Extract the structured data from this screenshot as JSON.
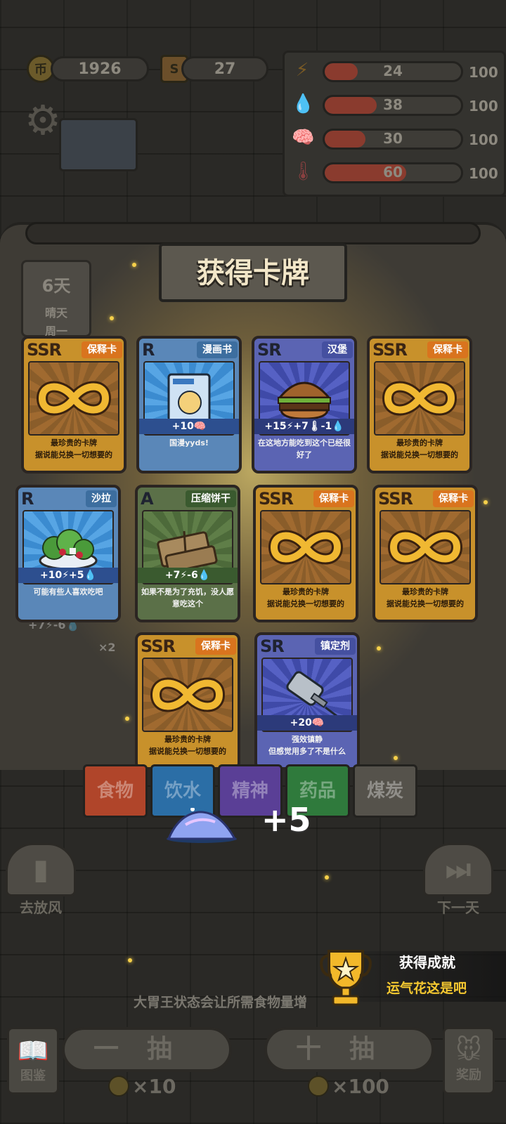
{
  "hud": {
    "coins": "1926",
    "tickets": "27",
    "coin_symbol": "币",
    "ticket_symbol": "S",
    "stats": [
      {
        "icon": "lightning-icon",
        "glyph": "⚡",
        "value": "24",
        "max": "100",
        "level": 0.24
      },
      {
        "icon": "water-drop-icon",
        "glyph": "💧",
        "value": "38",
        "max": "100",
        "level": 0.38
      },
      {
        "icon": "brain-icon",
        "glyph": "🧠",
        "value": "30",
        "max": "100",
        "level": 0.3
      },
      {
        "icon": "thermometer-icon",
        "glyph": "🌡",
        "value": "60",
        "max": "100",
        "level": 0.6
      }
    ]
  },
  "panel": {
    "title": "获得卡牌",
    "day": "6天",
    "weather": "晴天",
    "weekday": "周一",
    "left_status": "+7⚡-6💧",
    "left_multiplier": "×2"
  },
  "cards": [
    {
      "rarity": "SSR",
      "tag": "保释卡",
      "style": "gold",
      "effect": "",
      "desc": "最珍贵的卡牌\n据说能兑换一切想要的",
      "art": "infinity-icon"
    },
    {
      "rarity": "R",
      "tag": "漫画书",
      "style": "blue",
      "effect": "+10🧠",
      "desc": "国漫yyds!",
      "art": "comic-book-icon"
    },
    {
      "rarity": "SR",
      "tag": "汉堡",
      "style": "violet",
      "effect": "+15⚡+7🌡-1💧",
      "desc": "在这地方能吃到这个已经很好了",
      "art": "burger-icon"
    },
    {
      "rarity": "SSR",
      "tag": "保释卡",
      "style": "gold",
      "effect": "",
      "desc": "最珍贵的卡牌\n据说能兑换一切想要的",
      "art": "infinity-icon"
    },
    {
      "rarity": "R",
      "tag": "沙拉",
      "style": "blue",
      "effect": "+10⚡+5💧",
      "desc": "可能有些人喜欢吃吧",
      "art": "salad-icon"
    },
    {
      "rarity": "A",
      "tag": "压缩饼干",
      "style": "green",
      "effect": "+7⚡-6💧",
      "desc": "如果不是为了充饥，没人愿意吃这个",
      "art": "biscuit-icon"
    },
    {
      "rarity": "SSR",
      "tag": "保释卡",
      "style": "gold",
      "effect": "",
      "desc": "最珍贵的卡牌\n据说能兑换一切想要的",
      "art": "infinity-icon"
    },
    {
      "rarity": "SSR",
      "tag": "保释卡",
      "style": "gold",
      "effect": "",
      "desc": "最珍贵的卡牌\n据说能兑换一切想要的",
      "art": "infinity-icon"
    },
    {
      "rarity": "SSR",
      "tag": "保释卡",
      "style": "gold",
      "effect": "",
      "desc": "最珍贵的卡牌\n据说能兑换一切想要的",
      "art": "infinity-icon"
    },
    {
      "rarity": "SR",
      "tag": "镇定剂",
      "style": "violet",
      "effect": "+20🧠",
      "desc": "强效镇静\n但感觉用多了不是什么",
      "art": "syringe-icon"
    }
  ],
  "tabs": [
    {
      "label": "食物",
      "color": "#b0452a"
    },
    {
      "label": "饮水",
      "color": "#2b6ea6"
    },
    {
      "label": "精神",
      "color": "#5a3f96"
    },
    {
      "label": "药品",
      "color": "#2f7a3c"
    },
    {
      "label": "煤炭",
      "color": "#55524b"
    }
  ],
  "reward": {
    "amount": "+5",
    "icon": "crystal-pile-icon"
  },
  "side_buttons": {
    "left": "去放风",
    "right": "下一天"
  },
  "achievement": {
    "title": "获得成就",
    "name": "运气花这是吧"
  },
  "hint": "大胃王状态会让所需食物量增",
  "draw": {
    "single_label": "一抽",
    "ten_label": "十抽",
    "single_cost": "×10",
    "ten_cost": "×100"
  },
  "corners": {
    "left": "图鉴",
    "right": "奖励"
  }
}
